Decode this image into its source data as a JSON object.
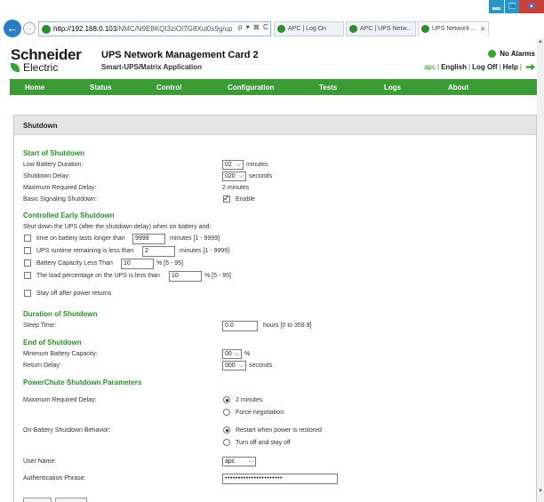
{
  "browser": {
    "url_host": "http://192.168.0.103",
    "url_path": "/NMC/N9E8KQI3ziOI7G8Xul0s9g/up",
    "address_tools": "ρ ▾ ⊠ C",
    "tabs": [
      {
        "label": "APC | Log On"
      },
      {
        "label": "APC | UPS Netw..."
      },
      {
        "label": "UPS Network ..."
      }
    ],
    "window_buttons": {
      "minimize": "▬",
      "maximize": "❐",
      "close": "✕"
    },
    "toolbar_icons": "⌂ ★ ✿"
  },
  "header": {
    "logo_line1": "Schneider",
    "logo_line2": "Electric",
    "product_title": "UPS Network Management Card 2",
    "product_subtitle": "Smart-UPS/Matrix Application",
    "alarm_text": "No Alarms",
    "user": "apc",
    "links": [
      "English",
      "Log Off",
      "Help"
    ]
  },
  "menu": [
    "Home",
    "Status",
    "Control",
    "Configuration",
    "Tests",
    "Logs",
    "About"
  ],
  "panel_title": "Shutdown",
  "start": {
    "heading": "Start of Shutdown",
    "low_battery_label": "Low Battery Duration:",
    "low_battery_value": "02",
    "low_battery_unit": "minutes",
    "shutdown_delay_label": "Shutdown Delay:",
    "shutdown_delay_value": "020",
    "shutdown_delay_unit": "seconds",
    "max_delay_label": "Maximum Required Delay:",
    "max_delay_value": "2 minutes",
    "basic_signal_label": "Basic Signaling Shutdown:",
    "basic_signal_option": "Enable"
  },
  "early": {
    "heading": "Controlled Early Shutdown",
    "intro": "Shut down the UPS (after the shutdown delay) when on battery and:",
    "opt1_label": "time on battery lasts longer than",
    "opt1_value": "9999",
    "opt1_unit": "minutes  [1 - 9999]",
    "opt2_label": "UPS runtime remaining is less than",
    "opt2_value": "2",
    "opt2_unit": "minutes  [1 - 9999]",
    "opt3_label": "Battery Capacity Less Than",
    "opt3_value": "10",
    "opt3_unit": "% [5 - 95]",
    "opt4_label": "The load percentage on the UPS is less than",
    "opt4_value": "10",
    "opt4_unit": "% [5 - 95]",
    "stay_off_label": "Stay off after power returns"
  },
  "duration": {
    "heading": "Duration of Shutdown",
    "sleep_label": "Sleep Time:",
    "sleep_value": "0.0",
    "sleep_unit": "hours [0 to 359.9]"
  },
  "end": {
    "heading": "End of Shutdown",
    "min_cap_label": "Minimum Battery Capacity:",
    "min_cap_value": "00",
    "min_cap_unit": "%",
    "return_delay_label": "Return Delay:",
    "return_delay_value": "000",
    "return_delay_unit": "seconds"
  },
  "powerchute": {
    "heading": "PowerChute Shutdown Parameters",
    "max_delay_label": "Maximum Required Delay:",
    "max_delay_opt1": "2 minutes",
    "max_delay_opt2": "Force negotiation",
    "behavior_label": "On-Battery Shutdown Behavior:",
    "behavior_opt1": "Restart when power is restored",
    "behavior_opt2": "Turn off and stay off",
    "user_label": "User Name:",
    "user_value": "apc",
    "auth_label": "Authentication Phrase:",
    "auth_value": "••••••••••••••••••••••"
  }
}
